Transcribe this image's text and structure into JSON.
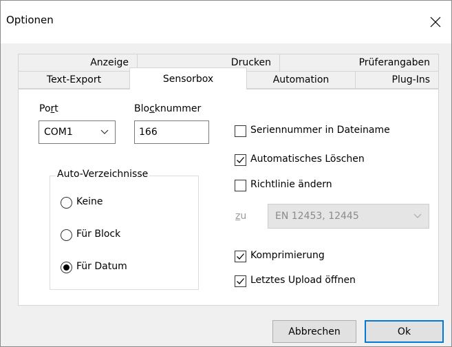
{
  "window": {
    "title": "Optionen"
  },
  "tabs": {
    "row1": [
      "Anzeige",
      "Drucken",
      "Prüferangaben"
    ],
    "row2": [
      "Text-Export",
      "Sensorbox",
      "Automation",
      "Plug-Ins"
    ],
    "active": "Sensorbox"
  },
  "sensorbox": {
    "port": {
      "label_before": "Po",
      "label_accel": "r",
      "label_after": "t",
      "value": "COM1"
    },
    "blocknummer": {
      "label_before": "Blo",
      "label_accel": "c",
      "label_after": "knummer",
      "value": "166"
    },
    "auto_verzeichnisse": {
      "legend": "Auto-Verzeichnisse",
      "options": [
        {
          "label": "Keine",
          "checked": false
        },
        {
          "label": "Für Block",
          "checked": false
        },
        {
          "label": "Für Datum",
          "checked": true
        }
      ]
    },
    "checkboxes": [
      {
        "label": "Seriennummer in Dateiname",
        "checked": false
      },
      {
        "label": "Automatisches Löschen",
        "checked": true
      },
      {
        "label": "Richtlinie ändern",
        "checked": false
      },
      {
        "label": "Komprimierung",
        "checked": true
      },
      {
        "label": "Letztes Upload öffnen",
        "checked": true
      }
    ],
    "richtlinie": {
      "zu_label_accel": "z",
      "zu_label_after": "u",
      "value": "EN 12453, 12445"
    }
  },
  "buttons": {
    "cancel": "Abbrechen",
    "ok": "Ok"
  },
  "colors": {
    "titlebar": "#ffffff",
    "dialog": "#f0f0f0",
    "panel": "#ffffff",
    "default_button_border": "#0078d7"
  }
}
